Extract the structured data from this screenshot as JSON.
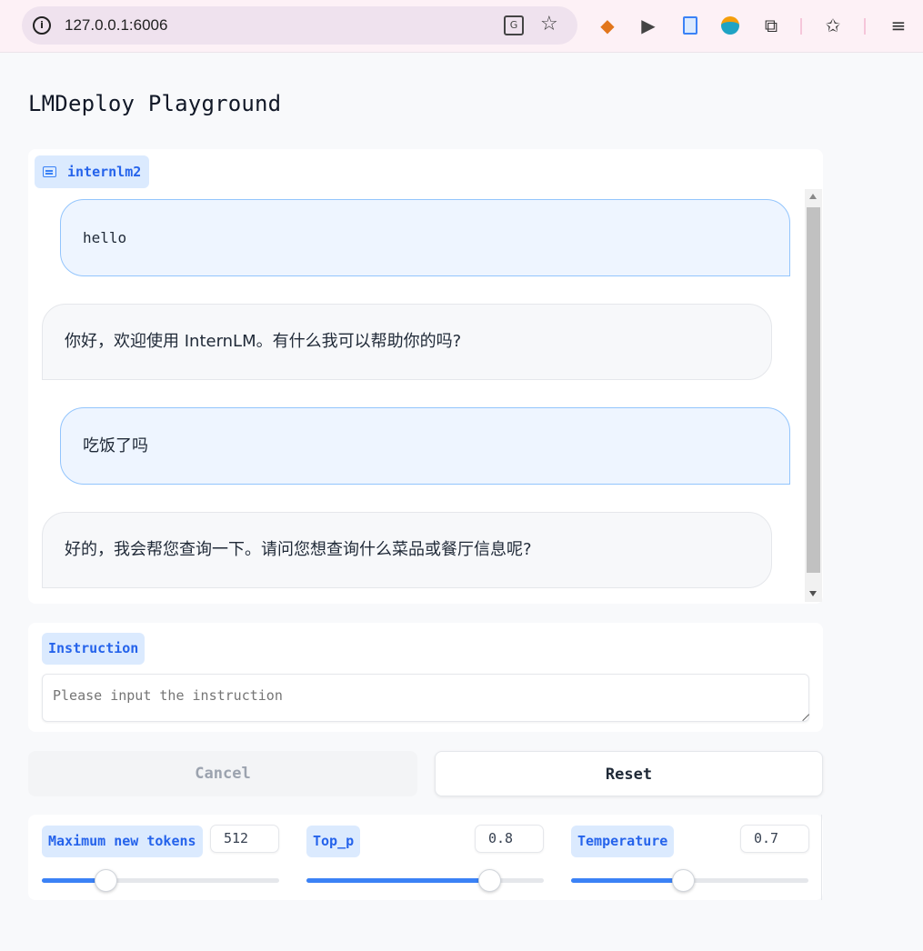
{
  "browser": {
    "url": "127.0.0.1:6006",
    "info_icon": "info-icon",
    "translate_icon": "translate-icon",
    "star_icon": "bookmark-star-icon",
    "extensions": [
      "metamask-fox-icon",
      "play-icon",
      "document-icon",
      "fruit-extension-icon",
      "puzzle-extensions-icon",
      "bookmarks-star-icon",
      "media-control-icon"
    ]
  },
  "page": {
    "title": "LMDeploy Playground"
  },
  "chat": {
    "label": "internlm2",
    "messages": [
      {
        "role": "user",
        "text": "hello"
      },
      {
        "role": "bot",
        "text": "你好，欢迎使用 InternLM。有什么我可以帮助你的吗?"
      },
      {
        "role": "user",
        "text": "吃饭了吗"
      },
      {
        "role": "bot",
        "text": "好的，我会帮您查询一下。请问您想查询什么菜品或餐厅信息呢?"
      }
    ]
  },
  "instruction": {
    "label": "Instruction",
    "placeholder": "Please input the instruction",
    "value": ""
  },
  "buttons": {
    "cancel": "Cancel",
    "reset": "Reset"
  },
  "params": {
    "max_tokens": {
      "label": "Maximum new tokens",
      "value": "512",
      "slider_fraction": 0.27
    },
    "top_p": {
      "label": "Top_p",
      "value": "0.8",
      "slider_fraction": 0.77
    },
    "temperature": {
      "label": "Temperature",
      "value": "0.7",
      "slider_fraction": 0.47
    }
  },
  "colors": {
    "accent": "#3b82f6",
    "label_bg": "#dbeafe",
    "label_text": "#2563eb",
    "user_bubble": "#eef5ff",
    "bot_bubble": "#f7f8fa"
  }
}
